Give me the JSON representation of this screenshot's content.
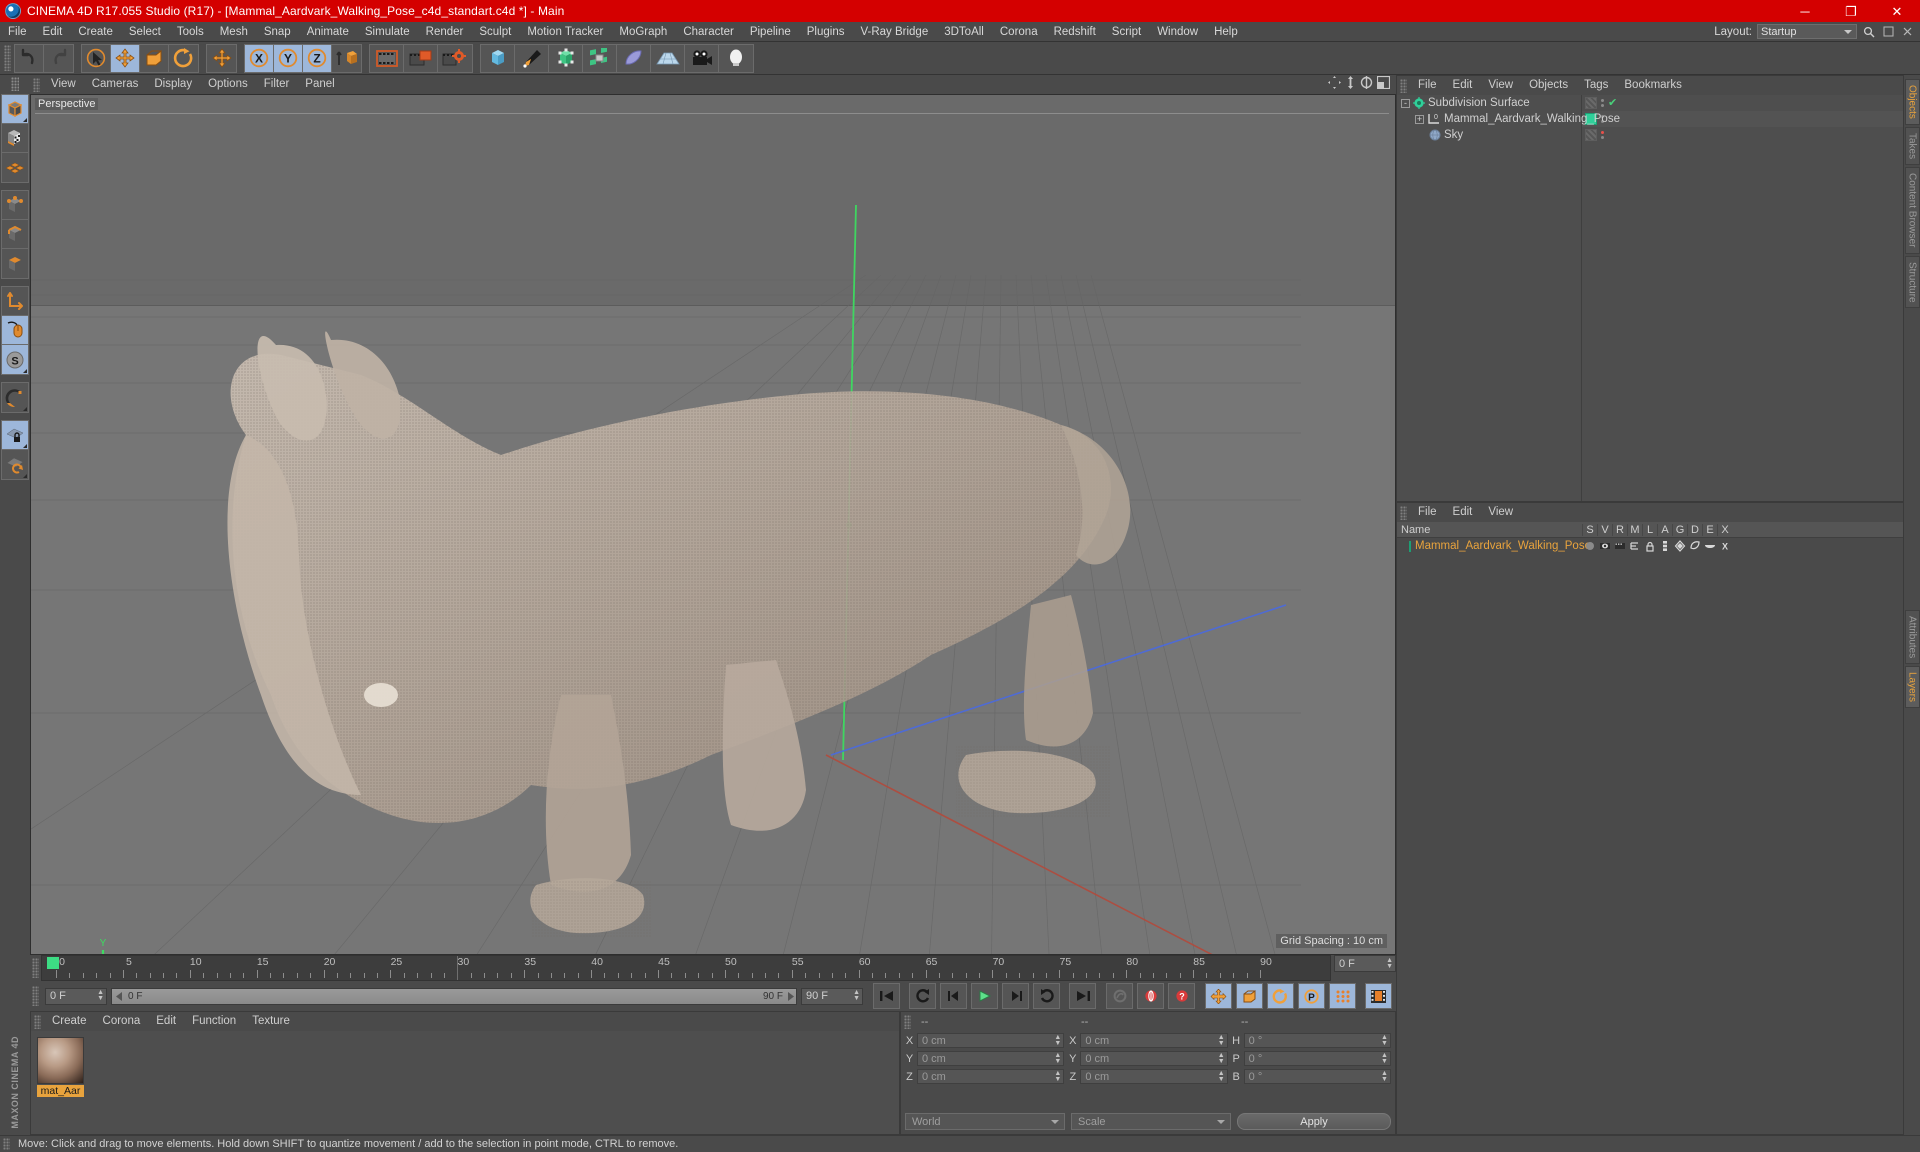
{
  "window": {
    "title": "CINEMA 4D R17.055 Studio (R17) - [Mammal_Aardvark_Walking_Pose_c4d_standart.c4d *] - Main",
    "minimize": "─",
    "maximize": "❐",
    "close": "✕",
    "accent_red": "#d40000",
    "accent_orange": "#e8a33d"
  },
  "menubar": {
    "items": [
      {
        "label": "File"
      },
      {
        "label": "Edit"
      },
      {
        "label": "Create"
      },
      {
        "label": "Select"
      },
      {
        "label": "Tools"
      },
      {
        "label": "Mesh"
      },
      {
        "label": "Snap"
      },
      {
        "label": "Animate"
      },
      {
        "label": "Simulate"
      },
      {
        "label": "Render"
      },
      {
        "label": "Sculpt"
      },
      {
        "label": "Motion Tracker"
      },
      {
        "label": "MoGraph"
      },
      {
        "label": "Character"
      },
      {
        "label": "Pipeline"
      },
      {
        "label": "Plugins"
      },
      {
        "label": "V-Ray Bridge"
      },
      {
        "label": "3DToAll"
      },
      {
        "label": "Corona"
      },
      {
        "label": "Redshift"
      },
      {
        "label": "Script"
      },
      {
        "label": "Window"
      },
      {
        "label": "Help"
      }
    ],
    "layout_label": "Layout:",
    "layout_value": "Startup",
    "search_icon": "search-icon"
  },
  "toolbar": {
    "groups": [
      {
        "buttons": [
          {
            "name": "undo-button",
            "icon": "undo-icon",
            "active": false
          },
          {
            "name": "redo-button",
            "icon": "redo-icon",
            "active": false
          }
        ]
      },
      {
        "buttons": [
          {
            "name": "live-selection-button",
            "icon": "cursor-select-icon",
            "active": false
          },
          {
            "name": "move-button",
            "icon": "move-icon",
            "active": true
          },
          {
            "name": "scale-button",
            "icon": "scale-icon",
            "active": false
          },
          {
            "name": "rotate-button",
            "icon": "rotate-icon",
            "active": false
          }
        ]
      },
      {
        "buttons": [
          {
            "name": "world-axis-button",
            "icon": "axis-move-icon",
            "active": false
          }
        ]
      },
      {
        "buttons": [
          {
            "name": "x-axis-lock-button",
            "icon": "x-axis-icon",
            "active": true
          },
          {
            "name": "y-axis-lock-button",
            "icon": "y-axis-icon",
            "active": true
          },
          {
            "name": "z-axis-lock-button",
            "icon": "z-axis-icon",
            "active": true
          },
          {
            "name": "world-object-toggle-button",
            "icon": "world-coordinate-icon",
            "active": false
          }
        ]
      },
      {
        "buttons": [
          {
            "name": "render-view-button",
            "icon": "render-view-icon",
            "active": false
          },
          {
            "name": "render-region-button",
            "icon": "render-region-icon",
            "active": false
          },
          {
            "name": "render-settings-button",
            "icon": "render-settings-icon",
            "active": false
          }
        ]
      },
      {
        "buttons": [
          {
            "name": "add-cube-button",
            "icon": "cube-primitive-icon",
            "active": false
          },
          {
            "name": "add-spline-button",
            "icon": "pen-spline-icon",
            "active": false
          },
          {
            "name": "add-generator-button",
            "icon": "nurbs-generator-icon",
            "active": false
          },
          {
            "name": "add-array-button",
            "icon": "array-modeling-icon",
            "active": false
          },
          {
            "name": "add-deformer-button",
            "icon": "bend-deformer-icon",
            "active": false
          },
          {
            "name": "add-floor-button",
            "icon": "floor-environment-icon",
            "active": false
          },
          {
            "name": "add-camera-button",
            "icon": "camera-icon",
            "active": false
          },
          {
            "name": "add-light-button",
            "icon": "light-bulb-icon",
            "active": false
          }
        ]
      }
    ]
  },
  "leftbar": {
    "brand": "MAXON CINEMA 4D",
    "groups": [
      {
        "buttons": [
          {
            "name": "object-mode-button",
            "icon": "cube-object-icon",
            "active": true,
            "corner": true
          },
          {
            "name": "texture-mode-button",
            "icon": "texture-checker-icon",
            "active": false,
            "corner": false
          },
          {
            "name": "polygon-grid-button",
            "icon": "polygon-grid-icon",
            "active": false,
            "corner": false
          }
        ]
      },
      {
        "buttons": [
          {
            "name": "points-mode-button",
            "icon": "point-mode-icon",
            "active": false,
            "corner": false
          },
          {
            "name": "edges-mode-button",
            "icon": "edge-mode-icon",
            "active": false,
            "corner": false
          },
          {
            "name": "polygons-mode-button",
            "icon": "polygon-mode-icon",
            "active": false,
            "corner": false
          }
        ]
      },
      {
        "buttons": [
          {
            "name": "enable-axis-button",
            "icon": "axis-modify-icon",
            "active": false,
            "corner": false
          },
          {
            "name": "viewport-solo-button",
            "icon": "mouse-pointer-icon",
            "active": true,
            "corner": false
          },
          {
            "name": "snap-toggle-button",
            "icon": "snap-s-icon",
            "active": true,
            "corner": true
          }
        ]
      },
      {
        "buttons": [
          {
            "name": "magnet-tool-button",
            "icon": "magnet-icon",
            "active": false,
            "corner": true
          }
        ]
      },
      {
        "buttons": [
          {
            "name": "workplane-lock-button",
            "icon": "workplane-lock-icon",
            "active": true,
            "corner": true
          },
          {
            "name": "workplane-rotate-button",
            "icon": "workplane-rotate-icon",
            "active": false,
            "corner": true
          }
        ]
      }
    ]
  },
  "viewport": {
    "menu": [
      {
        "label": "View"
      },
      {
        "label": "Cameras"
      },
      {
        "label": "Display"
      },
      {
        "label": "Options"
      },
      {
        "label": "Filter"
      },
      {
        "label": "Panel"
      }
    ],
    "view_label": "Perspective",
    "grid_spacing": "Grid Spacing : 10 cm",
    "axis_labels": {
      "x": "X",
      "y": "Y",
      "z": "Z"
    },
    "corner_icons": [
      {
        "name": "viewport-pan-icon"
      },
      {
        "name": "viewport-dolly-icon"
      },
      {
        "name": "viewport-rotate-icon"
      },
      {
        "name": "viewport-maximize-icon"
      }
    ],
    "axis_colors": {
      "x": "#e04a4a",
      "y": "#3ddc60",
      "z": "#4a6ae0"
    }
  },
  "timeline": {
    "ticks": [
      0,
      5,
      10,
      15,
      20,
      25,
      30,
      35,
      40,
      45,
      50,
      55,
      60,
      65,
      70,
      75,
      80,
      85,
      90
    ],
    "min_frame": 0,
    "max_frame": 90,
    "current_frame_field": "0 F",
    "end_frame_field": "90 F",
    "range_start_field": "0 F",
    "range_end_field": "90 F",
    "scrub_left_label": "0 F",
    "scrub_right_label": "90 F",
    "controls": [
      {
        "name": "go-to-start-button",
        "icon": "skip-start-icon",
        "active": false
      },
      {
        "name": "go-to-previous-key-button",
        "icon": "prev-key-icon",
        "active": false
      },
      {
        "name": "step-back-button",
        "icon": "step-back-icon",
        "active": false
      },
      {
        "name": "play-button",
        "icon": "play-icon",
        "active": false
      },
      {
        "name": "step-forward-button",
        "icon": "step-forward-icon",
        "active": false
      },
      {
        "name": "go-to-next-key-button",
        "icon": "next-key-icon",
        "active": false
      },
      {
        "name": "go-to-end-button",
        "icon": "skip-end-icon",
        "active": false
      },
      {
        "name": "record-active-objects-button",
        "icon": "record-key-icon",
        "active": false
      },
      {
        "name": "autokeying-button",
        "icon": "autokey-icon",
        "active": false
      },
      {
        "name": "keyframe-selection-button",
        "icon": "keyframe-help-icon",
        "active": false
      },
      {
        "name": "position-key-button",
        "icon": "position-key-icon",
        "active": true
      },
      {
        "name": "scale-key-button",
        "icon": "scale-key-icon",
        "active": true
      },
      {
        "name": "rotation-key-button",
        "icon": "rotation-key-icon",
        "active": true
      },
      {
        "name": "parameter-key-button",
        "icon": "parameter-key-icon",
        "active": true
      },
      {
        "name": "point-level-animation-button",
        "icon": "pla-dots-icon",
        "active": true
      },
      {
        "name": "timeline-view-button",
        "icon": "timeline-film-icon",
        "active": true
      }
    ]
  },
  "material_manager": {
    "menu": [
      {
        "label": "Create"
      },
      {
        "label": "Corona"
      },
      {
        "label": "Edit"
      },
      {
        "label": "Function"
      },
      {
        "label": "Texture"
      }
    ],
    "materials": [
      {
        "name": "mat_Aar",
        "selected": true
      }
    ]
  },
  "coordinates": {
    "header_position": "--",
    "header_size": "--",
    "header_rotation": "--",
    "rows": [
      {
        "pos_label": "X",
        "pos_value": "0 cm",
        "size_label": "X",
        "size_value": "0 cm",
        "rot_label": "H",
        "rot_value": "0 °"
      },
      {
        "pos_label": "Y",
        "pos_value": "0 cm",
        "size_label": "Y",
        "size_value": "0 cm",
        "rot_label": "P",
        "rot_value": "0 °"
      },
      {
        "pos_label": "Z",
        "pos_value": "0 cm",
        "size_label": "Z",
        "size_value": "0 cm",
        "rot_label": "B",
        "rot_value": "0 °"
      }
    ],
    "coord_system": "World",
    "size_mode": "Scale",
    "apply_label": "Apply"
  },
  "object_manager": {
    "menu": [
      {
        "label": "File"
      },
      {
        "label": "Edit"
      },
      {
        "label": "View"
      },
      {
        "label": "Objects"
      },
      {
        "label": "Tags"
      },
      {
        "label": "Bookmarks"
      }
    ],
    "objects": [
      {
        "name": "Subdivision Surface",
        "icon": "subdivision-surface-icon",
        "indent": 0,
        "expander": "-",
        "tag": "checker",
        "visible_check": true
      },
      {
        "name": "Mammal_Aardvark_Walking_Pose",
        "icon": "polygon-object-icon",
        "indent": 1,
        "expander": "+",
        "tag": "green",
        "visible_check": false
      },
      {
        "name": "Sky",
        "icon": "sky-object-icon",
        "indent": 1,
        "expander": "",
        "tag": "checker",
        "visible_check": false,
        "red_dot": true
      }
    ]
  },
  "attribute_manager": {
    "menu": [
      {
        "label": "File"
      },
      {
        "label": "Edit"
      },
      {
        "label": "View"
      }
    ],
    "name_column": "Name",
    "columns": [
      "S",
      "V",
      "R",
      "M",
      "L",
      "A",
      "G",
      "D",
      "E",
      "X"
    ],
    "rows": [
      {
        "name": "Mammal_Aardvark_Walking_Pose",
        "swatch": "#2fd09a"
      }
    ]
  },
  "vertical_tabs": {
    "top": [
      {
        "label": "Objects",
        "active": true
      },
      {
        "label": "Takes",
        "active": false
      },
      {
        "label": "Content Browser",
        "active": false
      },
      {
        "label": "Structure",
        "active": false
      }
    ],
    "bottom": [
      {
        "label": "Attributes",
        "active": false
      },
      {
        "label": "Layers",
        "active": true
      }
    ]
  },
  "statusbar": {
    "message": "Move: Click and drag to move elements. Hold down SHIFT to quantize movement / add to the selection in point mode, CTRL to remove."
  }
}
